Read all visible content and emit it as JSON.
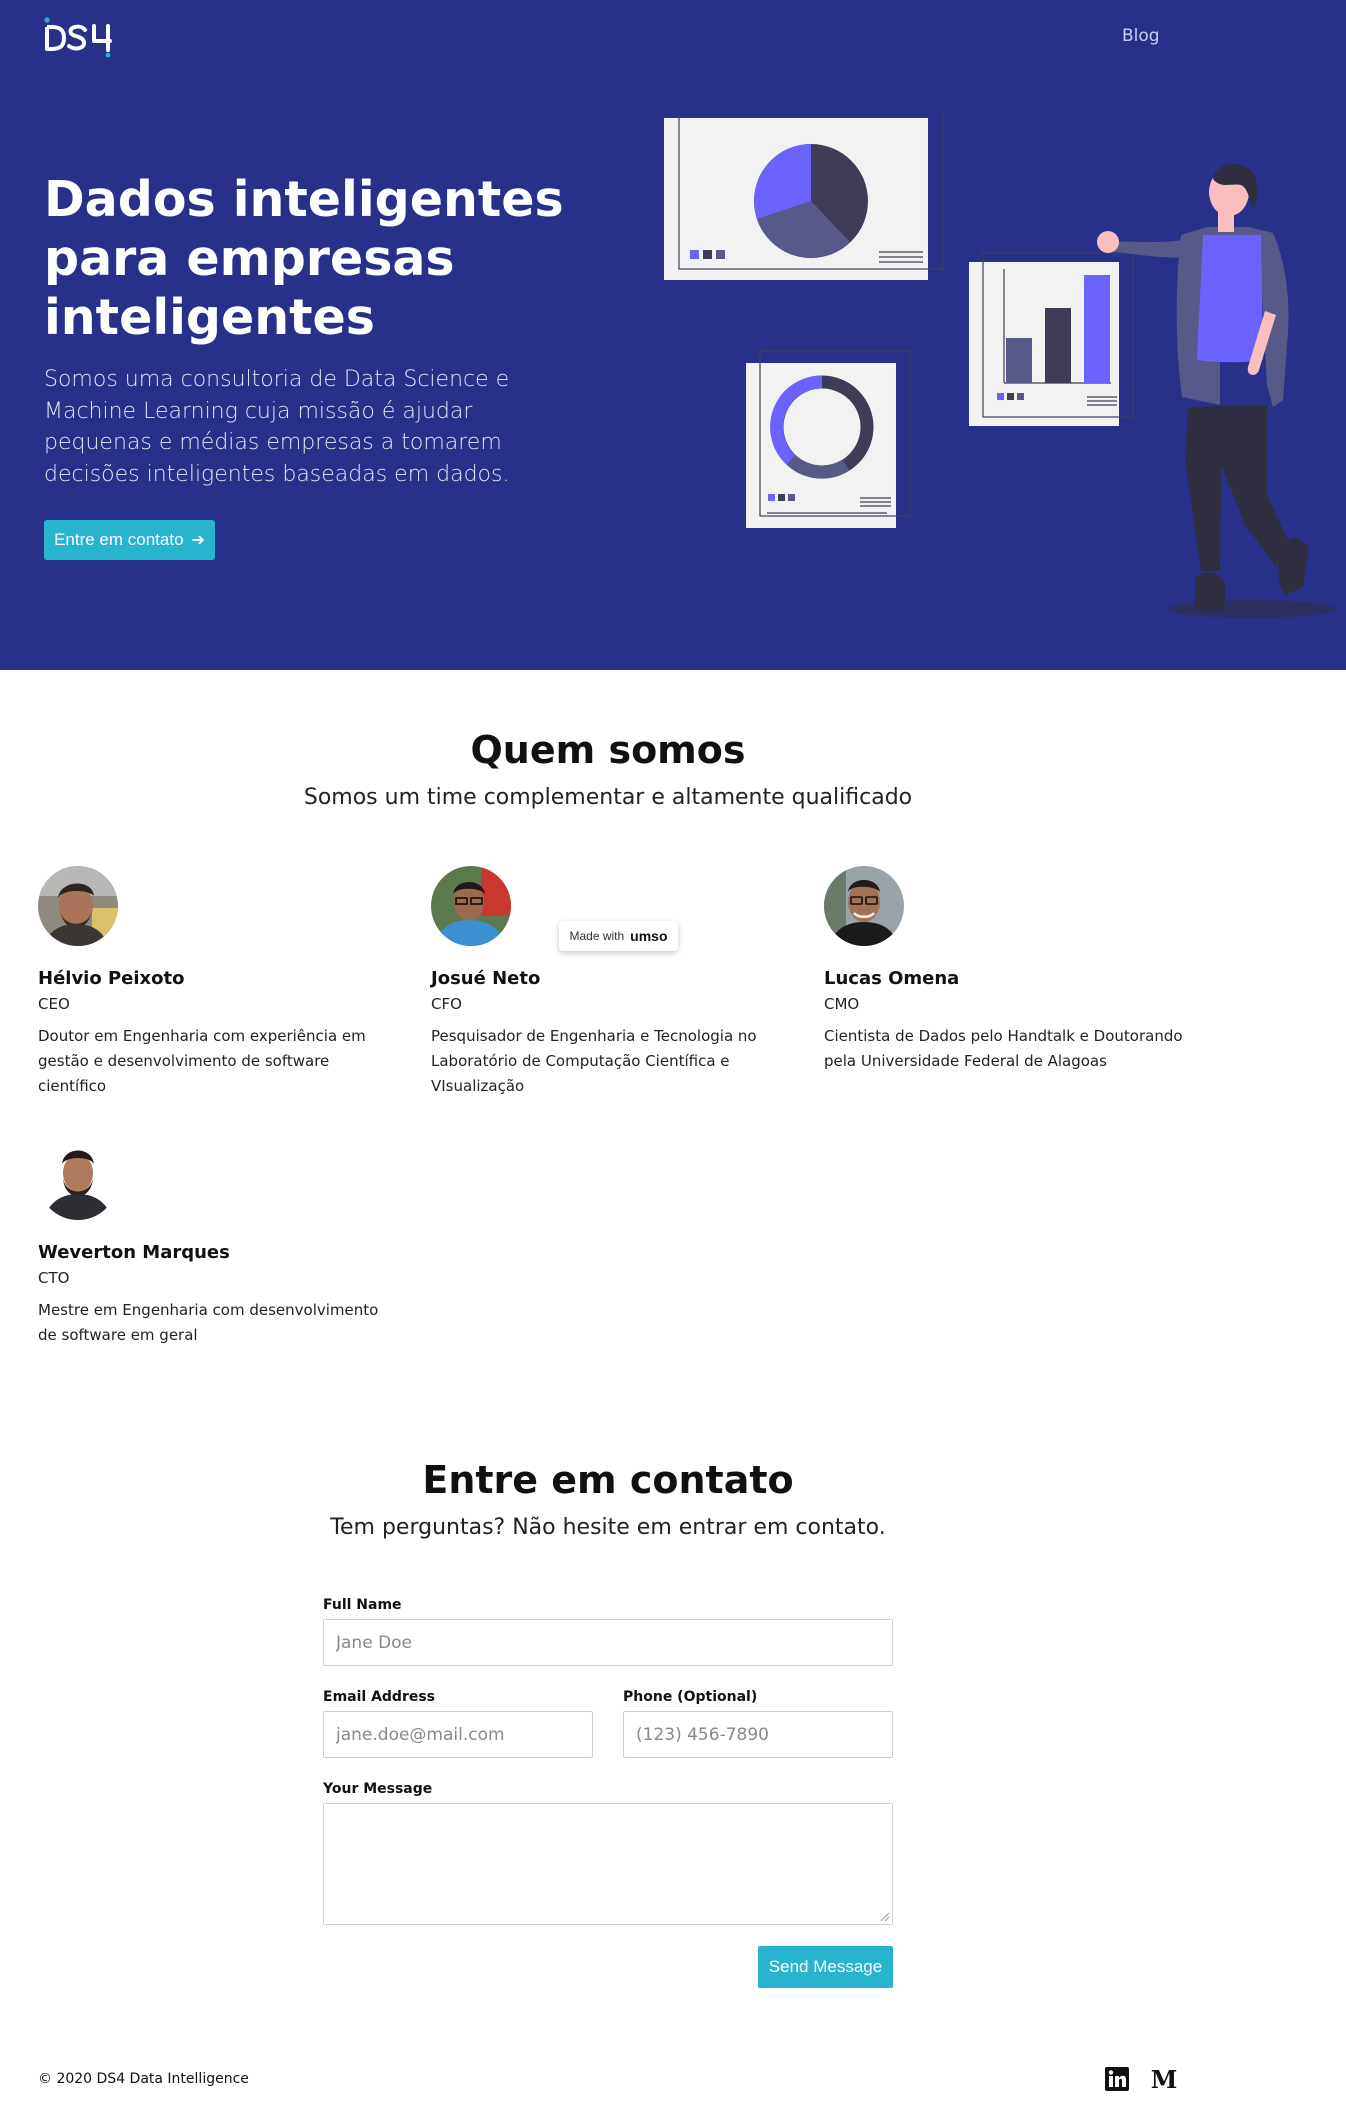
{
  "nav": {
    "logo_alt": "DS4",
    "blog_label": "Blog"
  },
  "hero": {
    "title": "Dados inteligentes para empresas inteligentes",
    "subtitle": "Somos uma consultoria de Data Science e Machine Learning cuja missão é ajudar pequenas e médias empresas a tomarem decisões inteligentes baseadas em dados.",
    "cta_label": "Entre em contato",
    "cta_icon": "arrow-right-icon"
  },
  "team": {
    "title": "Quem somos",
    "subtitle": "Somos um time complementar e altamente qualificado",
    "members": [
      {
        "name": "Hélvio Peixoto",
        "role": "CEO",
        "bio": "Doutor em Engenharia com experiência em gestão e desenvolvimento de software científico"
      },
      {
        "name": "Josué Neto",
        "role": "CFO",
        "bio": "Pesquisador de Engenharia e Tecnologia no Laboratório de Computação Científica e VIsualização"
      },
      {
        "name": "Lucas Omena",
        "role": "CMO",
        "bio": "Cientista de Dados pelo Handtalk e Doutorando pela Universidade Federal de Alagoas"
      },
      {
        "name": "Weverton Marques",
        "role": "CTO",
        "bio": "Mestre em Engenharia com desenvolvimento de software em geral"
      }
    ]
  },
  "badge": {
    "made_with": "Made with",
    "brand": "umso"
  },
  "contact": {
    "title": "Entre em contato",
    "subtitle": "Tem perguntas? Não hesite em entrar em contato.",
    "full_name_label": "Full Name",
    "full_name_placeholder": "Jane Doe",
    "email_label": "Email Address",
    "email_placeholder": "jane.doe@mail.com",
    "phone_label": "Phone (Optional)",
    "phone_placeholder": "(123) 456-7890",
    "message_label": "Your Message",
    "message_value": "",
    "send_label": "Send Message"
  },
  "footer": {
    "copyright": "© 2020 DS4 Data Intelligence",
    "social": [
      "linkedin-icon",
      "medium-icon"
    ]
  },
  "colors": {
    "hero_bg": "#28308a",
    "accent": "#26b4cf",
    "illustration_purple": "#6c63ff",
    "illustration_dark": "#3f3d56"
  }
}
